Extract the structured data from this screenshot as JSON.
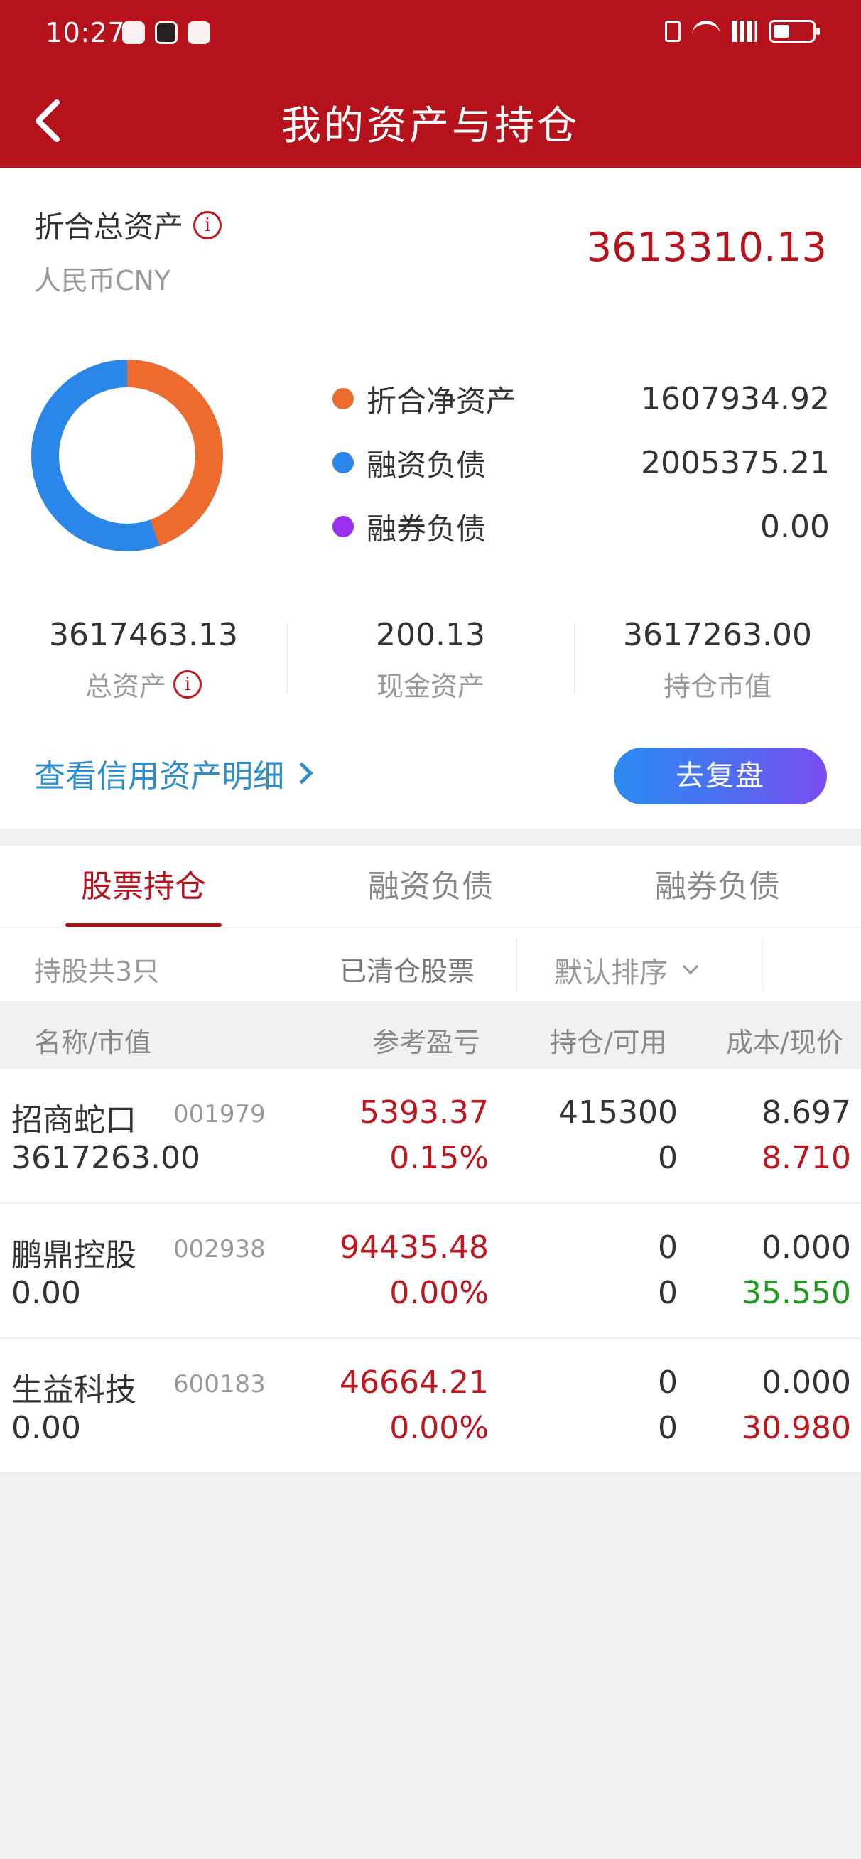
{
  "status_bar": {
    "time": "10:27"
  },
  "header": {
    "title": "我的资产与持仓"
  },
  "summary": {
    "total_label": "折合总资产",
    "currency": "人民币CNY",
    "total_value": "3613310.13",
    "donut": {
      "net_assets_fraction": 0.445,
      "financing_debt_fraction": 0.555,
      "short_debt_fraction": 0.0
    },
    "legend": [
      {
        "label": "折合净资产",
        "value": "1607934.92",
        "color": "#ee6b2e"
      },
      {
        "label": "融资负债",
        "value": "2005375.21",
        "color": "#2b86ea"
      },
      {
        "label": "融券负债",
        "value": "0.00",
        "color": "#9b2ff0"
      }
    ],
    "stats": [
      {
        "value": "3617463.13",
        "label": "总资产"
      },
      {
        "value": "200.13",
        "label": "现金资产"
      },
      {
        "value": "3617263.00",
        "label": "持仓市值"
      }
    ],
    "detail_link": "查看信用资产明细",
    "review_button": "去复盘"
  },
  "tabs": [
    "股票持仓",
    "融资负债",
    "融券负债"
  ],
  "active_tab": 0,
  "filter": {
    "count_text": "持股共3只",
    "cleared_text": "已清仓股票",
    "sort_text": "默认排序"
  },
  "table_header": {
    "name": "名称/市值",
    "pl": "参考盈亏",
    "hold": "持仓/可用",
    "cost": "成本/现价"
  },
  "holdings": [
    {
      "name": "招商蛇口",
      "code": "001979",
      "market_value": "3617263.00",
      "pl": "5393.37",
      "pl_pct": "0.15%",
      "hold": "415300",
      "avail": "0",
      "cost": "8.697",
      "price": "8.710",
      "price_color": "#c0161f"
    },
    {
      "name": "鹏鼎控股",
      "code": "002938",
      "market_value": "0.00",
      "pl": "94435.48",
      "pl_pct": "0.00%",
      "hold": "0",
      "avail": "0",
      "cost": "0.000",
      "price": "35.550",
      "price_color": "#1f9a1f"
    },
    {
      "name": "生益科技",
      "code": "600183",
      "market_value": "0.00",
      "pl": "46664.21",
      "pl_pct": "0.00%",
      "hold": "0",
      "avail": "0",
      "cost": "0.000",
      "price": "30.980",
      "price_color": "#c0161f"
    }
  ],
  "colors": {
    "brand_red": "#b5121b",
    "link_blue": "#2a8fcc"
  }
}
